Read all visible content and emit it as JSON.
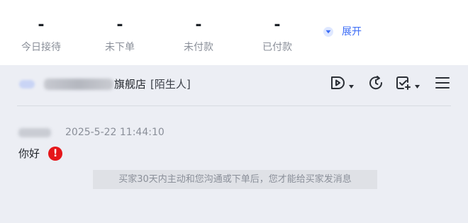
{
  "stats": [
    {
      "value": "-",
      "label": "今日接待"
    },
    {
      "value": "-",
      "label": "未下单"
    },
    {
      "value": "-",
      "label": "未付款"
    },
    {
      "value": "-",
      "label": "已付款"
    }
  ],
  "expand": {
    "label": "展开",
    "icon": "chevron-down-circle-icon"
  },
  "chat": {
    "shop_name": "旗舰店",
    "shop_tag": "[陌生人]",
    "toolbar_icons": [
      "video-invite-icon",
      "refresh-icon",
      "task-check-icon",
      "menu-icon"
    ],
    "message": {
      "time": "2025-5-22 11:44:10",
      "text": "你好",
      "error_mark": "!"
    },
    "notice": "买家30天内主动和您沟通或下单后，您才能给买家发消息"
  },
  "colors": {
    "accent": "#3b6cf6",
    "error": "#e5161a",
    "chat_bg": "#eceef4"
  }
}
